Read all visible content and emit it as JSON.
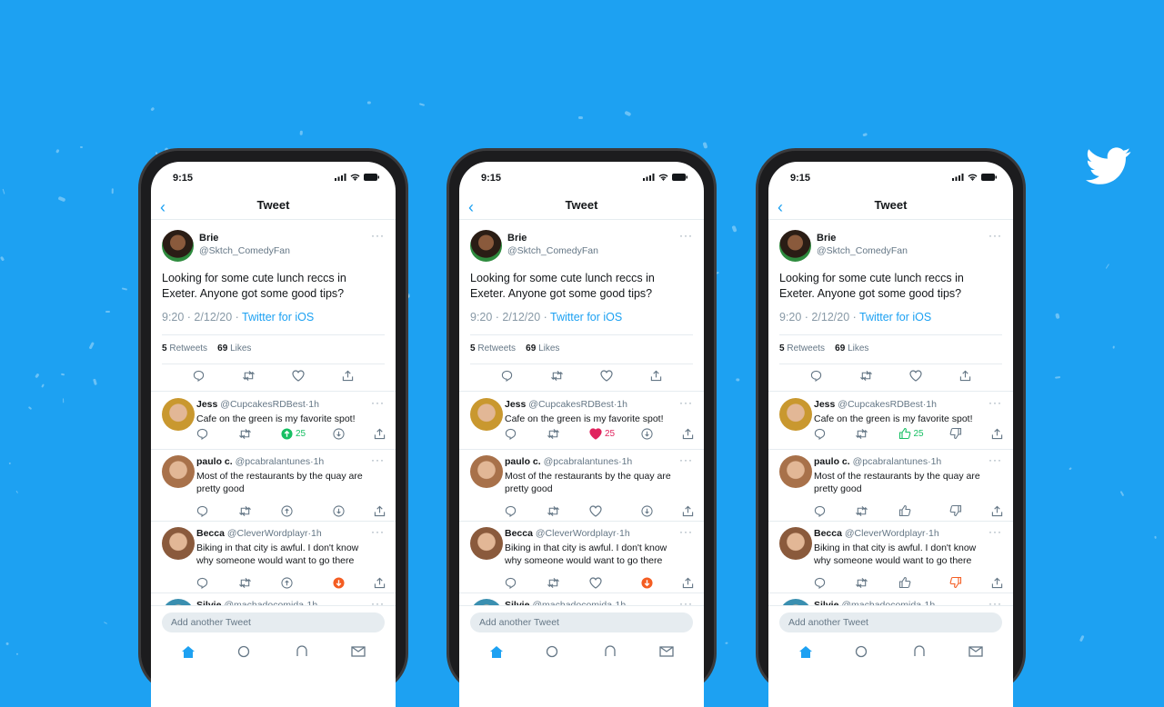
{
  "colors": {
    "background": "#1da1f2",
    "accent": "#1da1f2",
    "upvote": "#17bf63",
    "like": "#e0245e",
    "downvote": "#f45d22"
  },
  "brand_icon": "twitter-bird-icon",
  "phones": [
    {
      "status_time": "9:15",
      "header_title": "Tweet",
      "tweet": {
        "name": "Brie",
        "handle": "@Sktch_ComedyFan",
        "text_line1": "Looking for some cute lunch reccs in",
        "text_line2": "Exeter. Anyone got some good tips?",
        "time": "9:20 · 2/12/20 · ",
        "source": "Twitter for iOS",
        "retweets": "5",
        "retweets_label": "Retweets",
        "likes": "69",
        "likes_label": "Likes"
      },
      "vote_style": "arrows",
      "replies": [
        {
          "name": "Jess",
          "handle": "@CupcakesRDBest",
          "age": "·1h",
          "line1": "Cafe on the green is my favorite spot!",
          "line2": "",
          "up_active": true,
          "down_active": false,
          "count": "25"
        },
        {
          "name": "paulo c.",
          "handle": "@pcabralantunes",
          "age": "·1h",
          "line1": "Most of the restaurants by the quay are",
          "line2": "pretty good",
          "up_active": false,
          "down_active": false,
          "count": ""
        },
        {
          "name": "Becca",
          "handle": "@CleverWordplayr",
          "age": "·1h",
          "line1": "Biking in that city is awful. I don't know",
          "line2": "why someone would want to go there",
          "up_active": false,
          "down_active": true,
          "count": ""
        },
        {
          "name": "Silvie",
          "handle": "@machadocomida",
          "age": "·1h"
        }
      ],
      "input_placeholder": "Add another Tweet"
    },
    {
      "status_time": "9:15",
      "header_title": "Tweet",
      "tweet": {
        "name": "Brie",
        "handle": "@Sktch_ComedyFan",
        "text_line1": "Looking for some cute lunch reccs in",
        "text_line2": "Exeter. Anyone got some good tips?",
        "time": "9:20 · 2/12/20 · ",
        "source": "Twitter for iOS",
        "retweets": "5",
        "retweets_label": "Retweets",
        "likes": "69",
        "likes_label": "Likes"
      },
      "vote_style": "heart",
      "replies": [
        {
          "name": "Jess",
          "handle": "@CupcakesRDBest",
          "age": "·1h",
          "line1": "Cafe on the green is my favorite spot!",
          "line2": "",
          "up_active": true,
          "down_active": false,
          "count": "25"
        },
        {
          "name": "paulo c.",
          "handle": "@pcabralantunes",
          "age": "·1h",
          "line1": "Most of the restaurants by the quay are",
          "line2": "pretty good",
          "up_active": false,
          "down_active": false,
          "count": ""
        },
        {
          "name": "Becca",
          "handle": "@CleverWordplayr",
          "age": "·1h",
          "line1": "Biking in that city is awful. I don't know",
          "line2": "why someone would want to go there",
          "up_active": false,
          "down_active": true,
          "count": ""
        },
        {
          "name": "Silvie",
          "handle": "@machadocomida",
          "age": "·1h"
        }
      ],
      "input_placeholder": "Add another Tweet"
    },
    {
      "status_time": "9:15",
      "header_title": "Tweet",
      "tweet": {
        "name": "Brie",
        "handle": "@Sktch_ComedyFan",
        "text_line1": "Looking for some cute lunch reccs in",
        "text_line2": "Exeter. Anyone got some good tips?",
        "time": "9:20 · 2/12/20 · ",
        "source": "Twitter for iOS",
        "retweets": "5",
        "retweets_label": "Retweets",
        "likes": "69",
        "likes_label": "Likes"
      },
      "vote_style": "thumbs",
      "replies": [
        {
          "name": "Jess",
          "handle": "@CupcakesRDBest",
          "age": "·1h",
          "line1": "Cafe on the green is my favorite spot!",
          "line2": "",
          "up_active": true,
          "down_active": false,
          "count": "25"
        },
        {
          "name": "paulo c.",
          "handle": "@pcabralantunes",
          "age": "·1h",
          "line1": "Most of the restaurants by the quay are",
          "line2": "pretty good",
          "up_active": false,
          "down_active": false,
          "count": ""
        },
        {
          "name": "Becca",
          "handle": "@CleverWordplayr",
          "age": "·1h",
          "line1": "Biking in that city is awful. I don't know",
          "line2": "why someone would want to go there",
          "up_active": false,
          "down_active": true,
          "count": ""
        },
        {
          "name": "Silvie",
          "handle": "@machadocomida",
          "age": "·1h"
        }
      ],
      "input_placeholder": "Add another Tweet"
    }
  ]
}
